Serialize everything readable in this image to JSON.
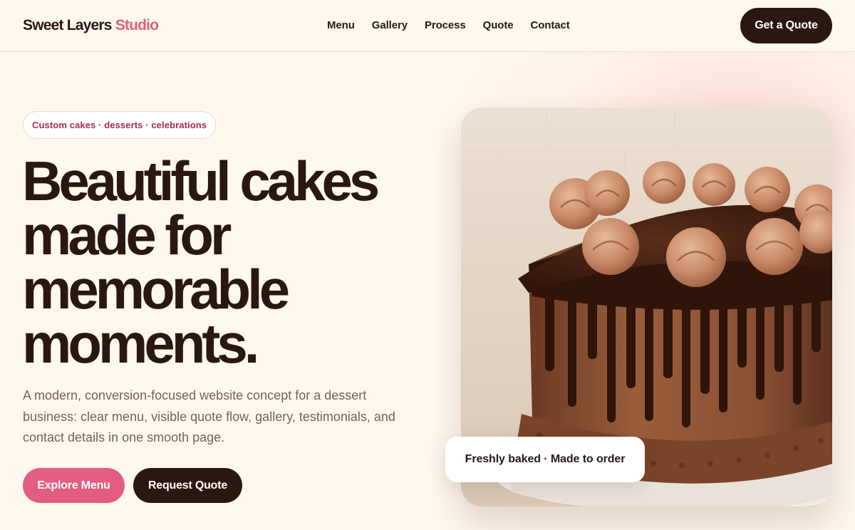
{
  "header": {
    "logo_main": "Sweet Layers",
    "logo_accent": "Studio",
    "nav": [
      {
        "label": "Menu"
      },
      {
        "label": "Gallery"
      },
      {
        "label": "Process"
      },
      {
        "label": "Quote"
      },
      {
        "label": "Contact"
      }
    ],
    "cta_label": "Get a Quote"
  },
  "hero": {
    "tag": "Custom cakes · desserts · celebrations",
    "title_lines": [
      "Beautiful cakes",
      "made for",
      "memorable",
      "moments."
    ],
    "lead": "A modern, conversion-focused website concept for a dessert business: clear menu, visible quote flow, gallery, testimonials, and contact details in one smooth page.",
    "primary_button": "Explore Menu",
    "secondary_button": "Request Quote",
    "image_badge": "Freshly baked · Made to order"
  },
  "colors": {
    "background": "#fff8ef",
    "dark": "#2a1712",
    "accent": "#e35d80",
    "tag_text": "#a82a4f",
    "muted_text": "#76625a"
  }
}
